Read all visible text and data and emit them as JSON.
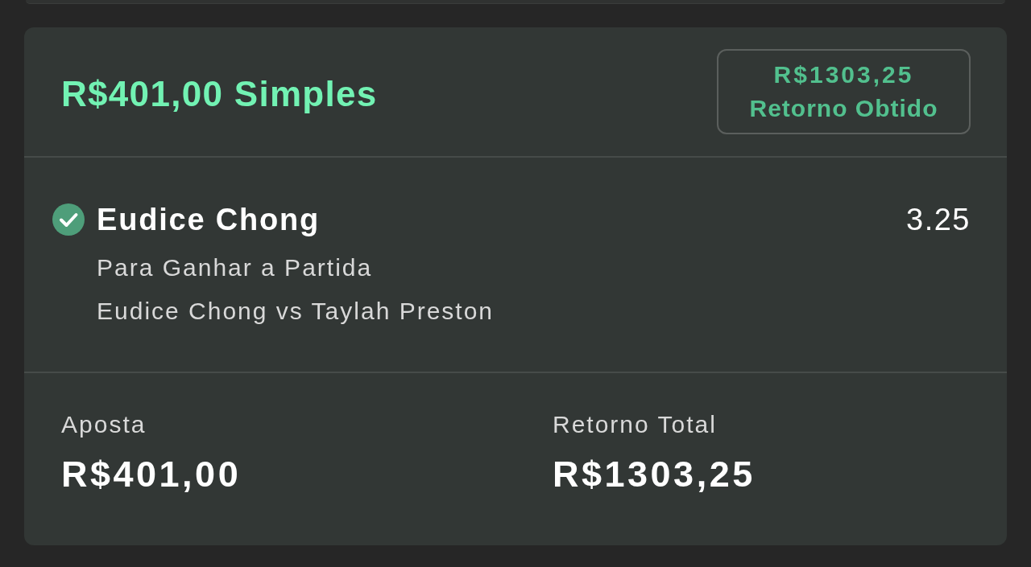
{
  "bet": {
    "stake_title": "R$401,00 Simples",
    "result_badge": {
      "amount": "R$1303,25",
      "label": "Retorno Obtido"
    }
  },
  "selections": [
    {
      "won": true,
      "name": "Eudice Chong",
      "odds": "3.25",
      "market": "Para Ganhar a Partida",
      "event": "Eudice Chong vs Taylah Preston"
    }
  ],
  "summary": [
    {
      "label": "Aposta",
      "value": "R$401,00"
    },
    {
      "label": "Retorno Total",
      "value": "R$1303,25"
    }
  ]
}
